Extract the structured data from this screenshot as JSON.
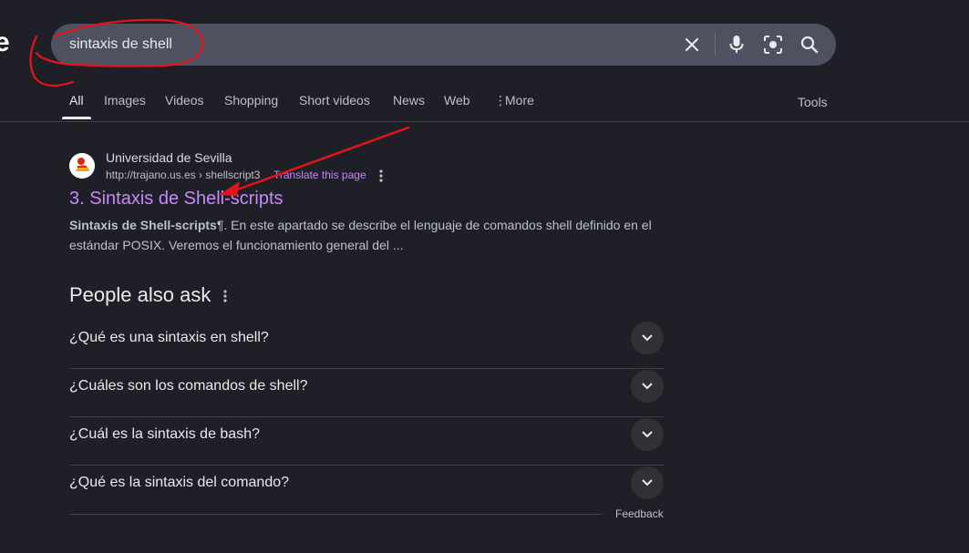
{
  "logo_fragment": "e",
  "search": {
    "query": "sintaxis de shell"
  },
  "tabs": [
    {
      "label": "All"
    },
    {
      "label": "Images"
    },
    {
      "label": "Videos"
    },
    {
      "label": "Shopping"
    },
    {
      "label": "Short videos"
    },
    {
      "label": "News"
    },
    {
      "label": "Web"
    },
    {
      "label": "More"
    }
  ],
  "tools_label": "Tools",
  "result": {
    "site_name": "Universidad de Sevilla",
    "url": "http://trajano.us.es › shellscript3",
    "translate": "Translate this page",
    "title": "3. Sintaxis de Shell-scripts",
    "snippet_bold": "Sintaxis de Shell-scripts",
    "snippet_rest": "¶. En este apartado se describe el lenguaje de comandos shell definido en el estándar POSIX. Veremos el funcionamiento general del ..."
  },
  "people_also_ask": {
    "title": "People also ask",
    "questions": [
      "¿Qué es una sintaxis en shell?",
      "¿Cuáles son los comandos de shell?",
      "¿Cuál es la sintaxis de bash?",
      "¿Qué es la sintaxis del comando?"
    ]
  },
  "feedback": "Feedback",
  "colors": {
    "background": "#1f1f27",
    "search_bar": "#4d5160",
    "visited_link": "#c58af9",
    "annotation_red": "#e5141c"
  }
}
